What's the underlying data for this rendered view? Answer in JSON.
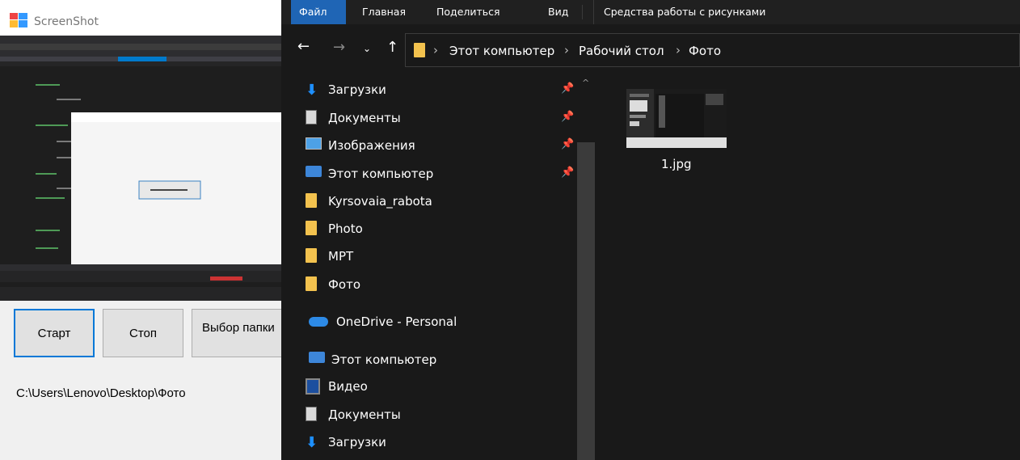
{
  "app": {
    "title": "ScreenShot",
    "buttons": {
      "start": "Старт",
      "stop": "Стоп",
      "folder": "Выбор папки"
    },
    "path": "C:\\Users\\Lenovo\\Desktop\\Фото"
  },
  "explorer": {
    "ribbon_tabs": {
      "file": "Файл",
      "home": "Главная",
      "share": "Поделиться",
      "view": "Вид",
      "tools": "Средства работы с рисунками"
    },
    "breadcrumb": [
      "Этот компьютер",
      "Рабочий стол",
      "Фото"
    ],
    "nav_items": [
      {
        "label": "Загрузки",
        "icon": "download-icon",
        "pinned": true
      },
      {
        "label": "Документы",
        "icon": "documents-icon",
        "pinned": true
      },
      {
        "label": "Изображения",
        "icon": "pictures-icon",
        "pinned": true
      },
      {
        "label": "Этот компьютер",
        "icon": "computer-icon",
        "pinned": true
      },
      {
        "label": "Kyrsovaia_rabota",
        "icon": "folder-icon",
        "pinned": false
      },
      {
        "label": "Photo",
        "icon": "folder-icon",
        "pinned": false
      },
      {
        "label": "MPT",
        "icon": "folder-icon",
        "pinned": false
      },
      {
        "label": "Фото",
        "icon": "folder-icon",
        "pinned": false
      },
      {
        "label": "OneDrive - Personal",
        "icon": "onedrive-icon",
        "pinned": false
      },
      {
        "label": "Этот компьютер",
        "icon": "computer-icon",
        "pinned": false
      },
      {
        "label": "Видео",
        "icon": "video-icon",
        "pinned": false
      },
      {
        "label": "Документы",
        "icon": "documents-icon",
        "pinned": false
      },
      {
        "label": "Загрузки",
        "icon": "download-icon",
        "pinned": false
      }
    ],
    "files": [
      {
        "name": "1.jpg"
      }
    ]
  }
}
